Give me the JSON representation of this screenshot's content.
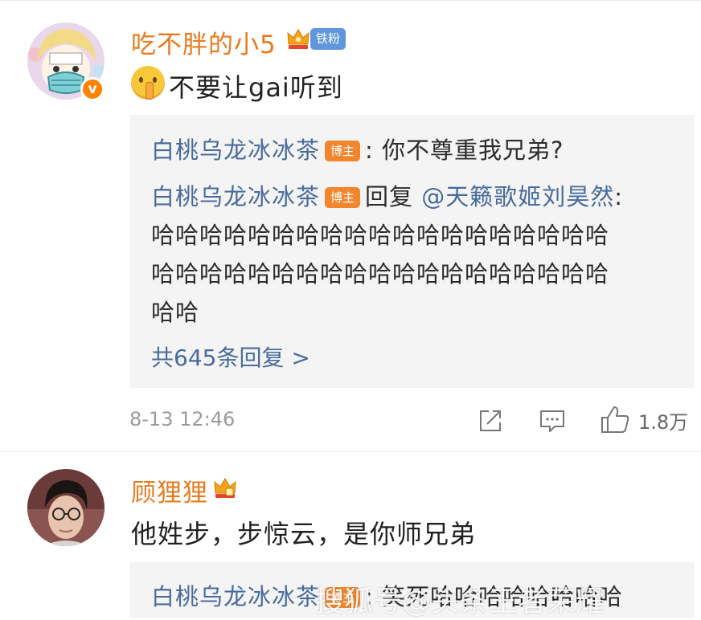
{
  "comments": [
    {
      "username": "吃不胖的小5",
      "fan_badge": "铁粉",
      "verified_mark": "v",
      "text": "不要让gai听到",
      "replies": [
        {
          "author": "白桃乌龙冰冰茶",
          "author_badge": "博主",
          "text": ": 你不尊重我兄弟?"
        },
        {
          "author": "白桃乌龙冰冰茶",
          "author_badge": "博主",
          "reply_word": "回复",
          "mention": "@天籁歌姬刘昊然",
          "mention_suffix": ":",
          "lines": [
            "哈哈哈哈哈哈哈哈哈哈哈哈哈哈哈哈哈哈哈",
            "哈哈哈哈哈哈哈哈哈哈哈哈哈哈哈哈哈哈哈",
            "哈哈"
          ]
        }
      ],
      "more_replies": "共645条回复 >",
      "timestamp": "8-13 12:46",
      "like_count": "1.8万"
    },
    {
      "username": "顾狸狸",
      "text": "他姓步，步惊云，是你师兄弟",
      "replies": [
        {
          "author": "白桃乌龙冰冰茶",
          "author_badge": "博主",
          "text": ": 笑死哈哈哈哈哈哈哈哈"
        }
      ]
    }
  ],
  "watermark": "搜狐号@头条王者荣耀",
  "colors": {
    "username": "#e87b1f",
    "link_blue": "#486b9c",
    "fan_badge": "#5f97dc",
    "owner_badge": "#f2862e",
    "reply_bg": "#f4f4f4",
    "meta_gray": "#9b9b9b"
  },
  "icons": [
    "crown-icon",
    "share-icon",
    "comment-icon",
    "like-icon",
    "shush-emoji"
  ]
}
